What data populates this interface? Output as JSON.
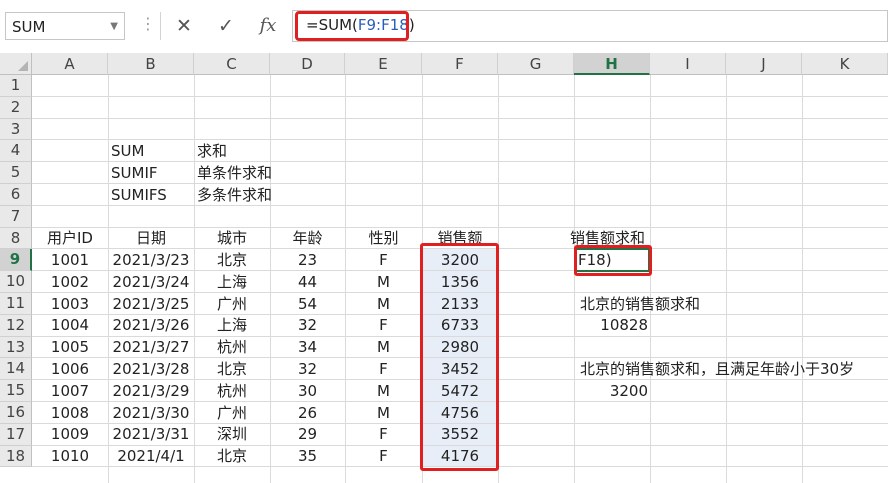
{
  "formula_bar": {
    "name_box": "SUM",
    "cancel_glyph": "✕",
    "enter_glyph": "✓",
    "fx_label": "fx",
    "formula_prefix": "=SUM(",
    "formula_ref": "F9:F18",
    "formula_suffix": ")"
  },
  "columns": [
    "A",
    "B",
    "C",
    "D",
    "E",
    "F",
    "G",
    "H",
    "I",
    "J",
    "K"
  ],
  "rows": [
    "1",
    "2",
    "3",
    "4",
    "5",
    "6",
    "7",
    "8",
    "9",
    "10",
    "11",
    "12",
    "13",
    "14",
    "15",
    "16",
    "17",
    "18"
  ],
  "functions": [
    {
      "name": "SUM",
      "desc": "求和"
    },
    {
      "name": "SUMIF",
      "desc": "单条件求和"
    },
    {
      "name": "SUMIFS",
      "desc": "多条件求和"
    }
  ],
  "table": {
    "headers": [
      "用户ID",
      "日期",
      "城市",
      "年龄",
      "性别",
      "销售额"
    ],
    "rows": [
      [
        "1001",
        "2021/3/23",
        "北京",
        "23",
        "F",
        "3200"
      ],
      [
        "1002",
        "2021/3/24",
        "上海",
        "44",
        "M",
        "1356"
      ],
      [
        "1003",
        "2021/3/25",
        "广州",
        "54",
        "M",
        "2133"
      ],
      [
        "1004",
        "2021/3/26",
        "上海",
        "32",
        "F",
        "6733"
      ],
      [
        "1005",
        "2021/3/27",
        "杭州",
        "34",
        "M",
        "2980"
      ],
      [
        "1006",
        "2021/3/28",
        "北京",
        "32",
        "F",
        "3452"
      ],
      [
        "1007",
        "2021/3/29",
        "杭州",
        "30",
        "M",
        "5472"
      ],
      [
        "1008",
        "2021/3/30",
        "广州",
        "26",
        "M",
        "4756"
      ],
      [
        "1009",
        "2021/3/31",
        "深圳",
        "29",
        "F",
        "3552"
      ],
      [
        "1010",
        "2021/4/1",
        "北京",
        "35",
        "F",
        "4176"
      ]
    ]
  },
  "side": {
    "h8": "销售额求和",
    "h9_edit": "F18)",
    "h11": "北京的销售额求和",
    "h12": "10828",
    "h14": "北京的销售额求和，且满足年龄小于30岁",
    "h15": "3200"
  },
  "colors": {
    "accent": "#217346",
    "highlight": "#e02020",
    "ref_blue": "#2b5eb9"
  }
}
